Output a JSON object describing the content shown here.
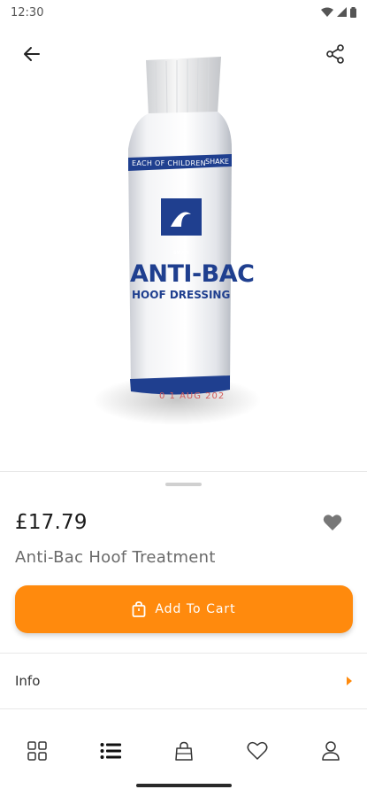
{
  "status_bar": {
    "time": "12:30"
  },
  "product": {
    "price": "£17.79",
    "title": "Anti-Bac Hoof Treatment",
    "bottle_label": {
      "banner_left": "EACH OF CHILDREN",
      "banner_right": "SHAKE",
      "brand": "SWAN",
      "name_line1": "ANTI-BAC",
      "name_line2": "HOOF DRESSING",
      "date_stamp": "0 1 AUG 202"
    }
  },
  "actions": {
    "add_to_cart": "Add To Cart"
  },
  "sections": {
    "info_label": "Info"
  },
  "nav": {
    "items": [
      {
        "icon": "grid-icon"
      },
      {
        "icon": "list-icon"
      },
      {
        "icon": "shopping-bag-icon"
      },
      {
        "icon": "heart-icon"
      },
      {
        "icon": "person-icon"
      }
    ]
  },
  "colors": {
    "accent": "#ff8a0d",
    "bottle_blue": "#1f3f8f"
  }
}
